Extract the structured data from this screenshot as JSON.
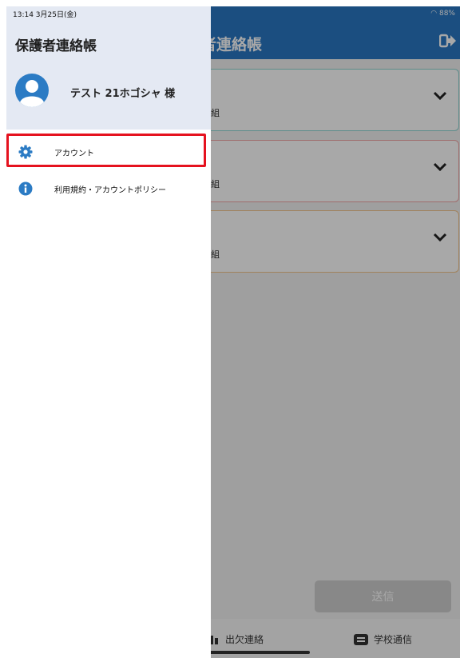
{
  "status_bar": {
    "time_date": "13:14  3月25日(金)",
    "battery": "88%"
  },
  "app_bar": {
    "title": "護者連絡帳"
  },
  "cards": [
    {
      "fragment": "組"
    },
    {
      "fragment": "組"
    },
    {
      "fragment": "組"
    }
  ],
  "send_button": {
    "label": "送信"
  },
  "bottom_nav": [
    {
      "label": "出欠連絡"
    },
    {
      "label": "学校通信"
    }
  ],
  "drawer": {
    "title": "保護者連絡帳",
    "user_name": "テスト 21ホゴシャ 様",
    "menu_items": [
      {
        "label": "アカウント",
        "icon": "gear-icon"
      },
      {
        "label": "利用規約・アカウントポリシー",
        "icon": "info-icon"
      }
    ]
  },
  "colors": {
    "app_bar": "#2a77c2",
    "drawer_header": "#e4e9f3",
    "highlight": "#e5121f",
    "icon": "#2b7bc4"
  }
}
